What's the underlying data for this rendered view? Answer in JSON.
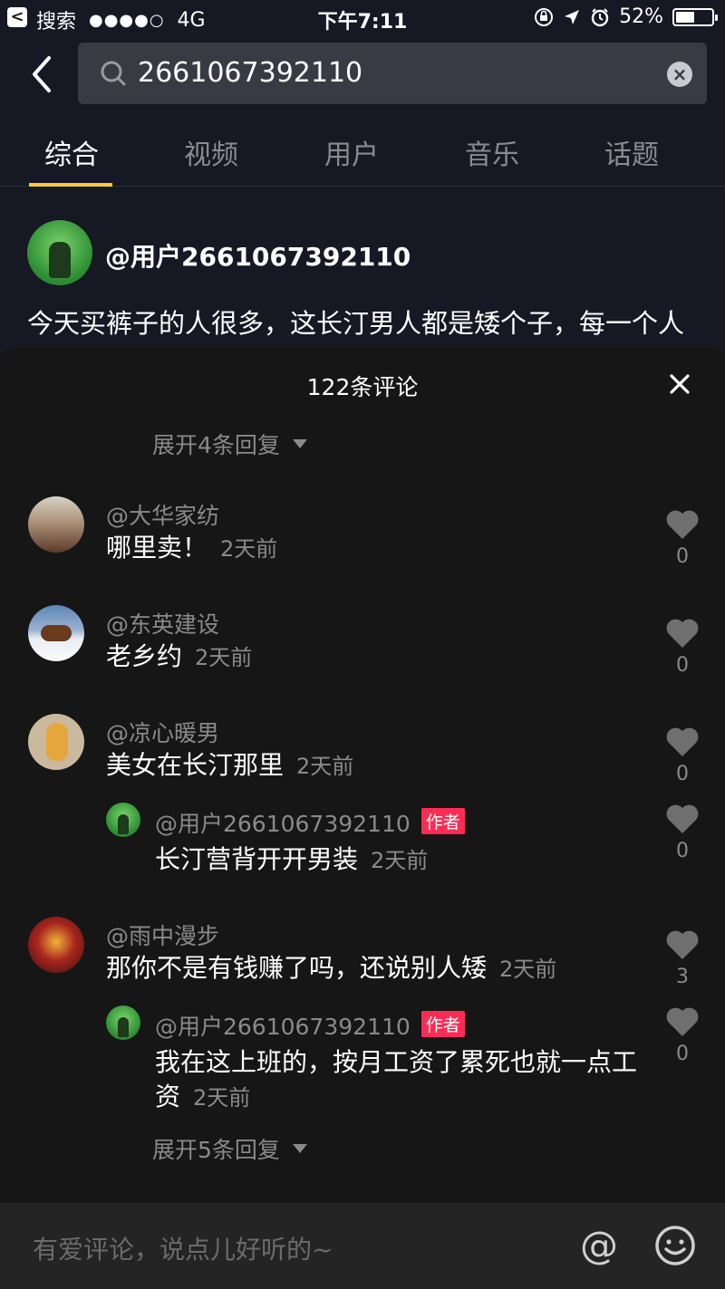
{
  "status_bar": {
    "back_label": "<",
    "carrier_app": "搜索",
    "signal": "●●●●○",
    "network": "4G",
    "time": "下午7:11",
    "battery_percent": "52%",
    "battery_level": 0.52
  },
  "search": {
    "value": "2661067392110"
  },
  "tabs": [
    {
      "label": "综合",
      "active": true
    },
    {
      "label": "视频",
      "active": false
    },
    {
      "label": "用户",
      "active": false
    },
    {
      "label": "音乐",
      "active": false
    },
    {
      "label": "话题",
      "active": false
    }
  ],
  "post": {
    "username": "@用户2661067392110",
    "text": "今天买裤子的人很多，这长汀男人都是矮个子，每一个人买了裤子都要剪裤脚边，都是我在用的我既酸背疼！"
  },
  "comments_sheet": {
    "title": "122条评论",
    "expand_top": "展开4条回复",
    "expand_bottom": "展开5条回复",
    "comments": [
      {
        "name": "@大华家纺",
        "text": "哪里卖！",
        "time": "2天前",
        "likes": "0"
      },
      {
        "name": "@东英建设",
        "text": "老乡约",
        "time": "2天前",
        "likes": "0"
      },
      {
        "name": "@凉心暖男",
        "text": "美女在长汀那里",
        "time": "2天前",
        "likes": "0",
        "reply": {
          "name": "@用户2661067392110",
          "badge": "作者",
          "text": "长汀营背开开男装",
          "time": "2天前",
          "likes": "0"
        }
      },
      {
        "name": "@雨中漫步",
        "text": "那你不是有钱赚了吗，还说别人矮",
        "time": "2天前",
        "likes": "3",
        "reply": {
          "name": "@用户2661067392110",
          "badge": "作者",
          "text": "我在这上班的，按月工资了累死也就一点工资",
          "time": "2天前",
          "likes": "0"
        }
      }
    ]
  },
  "input": {
    "placeholder": "有爱评论，说点儿好听的~",
    "at_symbol": "@"
  }
}
